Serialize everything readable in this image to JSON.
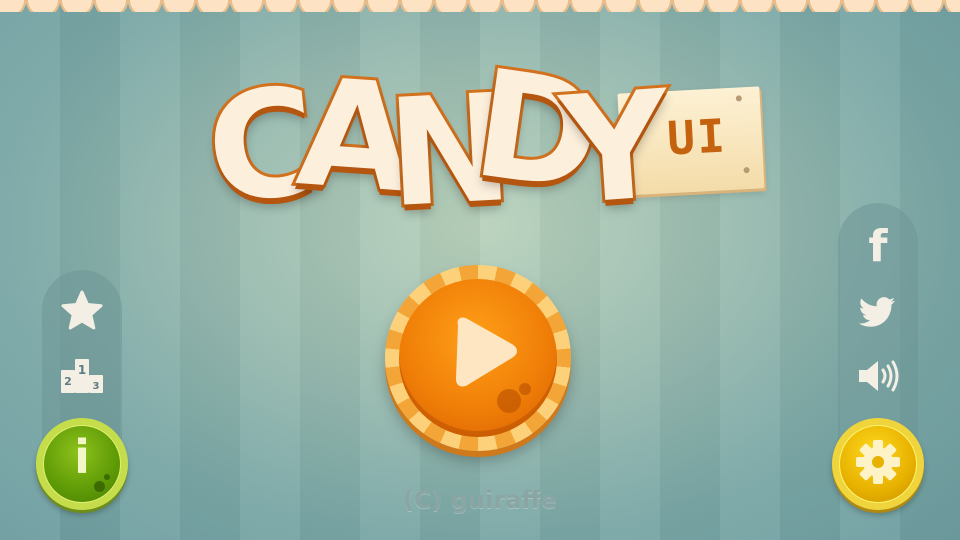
{
  "title": {
    "main_letters": [
      "C",
      "A",
      "N",
      "D",
      "Y"
    ],
    "subtitle": "UI"
  },
  "left_panel": {
    "icons": [
      "star-icon",
      "leaderboard-podium-icon"
    ],
    "podium_numbers": [
      "2",
      "1",
      "3"
    ]
  },
  "right_panel": {
    "icons": [
      "facebook-icon",
      "twitter-icon",
      "sound-icon"
    ],
    "facebook_glyph": "f"
  },
  "buttons": {
    "info_glyph": "i",
    "play": "play-icon",
    "settings": "gear-icon"
  },
  "credit": "(C) guiraffe",
  "colors": {
    "background": "#9cbdb1",
    "title_fill": "#fcefdc",
    "title_stroke": "#d2721f",
    "play": "#f07f08",
    "info": "#5e9a06",
    "settings": "#e7b100"
  }
}
